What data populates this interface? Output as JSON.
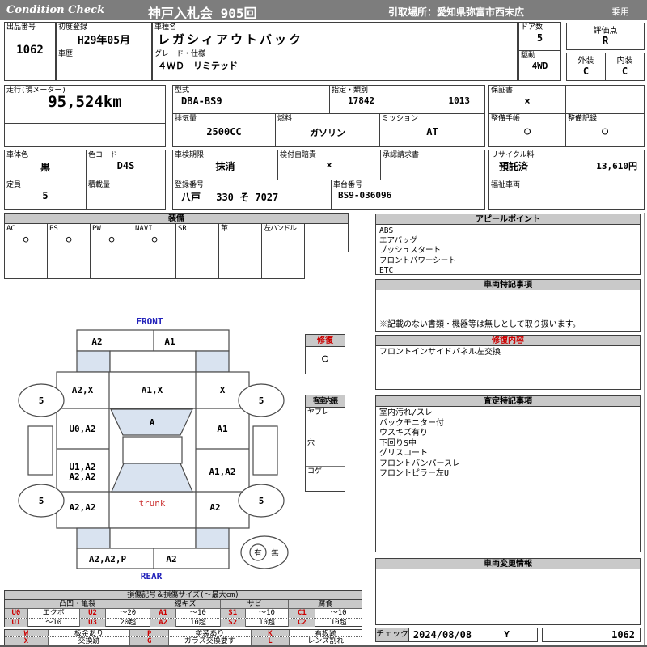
{
  "header": {
    "brand": "Condition  Check",
    "auction_title": "神戸入札会  905回",
    "pickup": "引取場所：愛知県弥富市西末広",
    "vehicle_class": "乗用"
  },
  "info": {
    "lot_label": "出品番号",
    "lot": "1062",
    "first_reg_label": "初度登録",
    "first_reg": "H29年05月",
    "history_label": "車歴",
    "model_label": "車種名",
    "model": "レガシィアウトバック",
    "grade_label": "グレード・仕様",
    "grade": "４ＷＤ　リミテッド",
    "doors_label": "ドア数",
    "doors": "5",
    "rating_label": "評価点",
    "rating": "R",
    "drive_label": "駆動",
    "drive": "4WD",
    "exterior_label": "外装",
    "exterior": "C",
    "interior_label": "内装",
    "interior": "C",
    "mileage_label": "走行(現メーター)",
    "mileage": "95,524km",
    "type_code_label": "型式",
    "type_code": "DBA-BS9",
    "class_label": "指定・類別",
    "class_no": "17842",
    "class_sub": "1013",
    "warranty_label": "保証書",
    "warranty": "×",
    "displacement_label": "排気量",
    "displacement": "2500CC",
    "fuel_label": "燃料",
    "fuel": "ガソリン",
    "mission_label": "ミッション",
    "mission": "AT",
    "book_label": "整備手帳",
    "book": "○",
    "record_label": "整備記録",
    "record": "○",
    "body_color_label": "車体色",
    "body_color": "黒",
    "color_code_label": "色コード",
    "color_code": "D4S",
    "inspection_label": "車検期限",
    "inspection": "抹消",
    "insurance_label": "検付自賠責",
    "insurance": "×",
    "approval_label": "承認請求書",
    "recycle_label": "リサイクル料",
    "recycle_status": "預託済",
    "recycle_fee": "13,610円",
    "capacity_label": "定員",
    "capacity": "5",
    "load_label": "積載量",
    "reg_no_label": "登録番号",
    "reg_no": "八戸　 330 そ 7027",
    "chassis_label": "車台番号",
    "chassis": "BS9-036096",
    "welfare_label": "福祉車両"
  },
  "equipment": {
    "title": "装備",
    "items": [
      {
        "label": "AC",
        "value": "○"
      },
      {
        "label": "PS",
        "value": "○"
      },
      {
        "label": "PW",
        "value": "○"
      },
      {
        "label": "NAVI",
        "value": "○"
      },
      {
        "label": "SR",
        "value": ""
      },
      {
        "label": "革",
        "value": ""
      },
      {
        "label": "左ハンドル",
        "value": ""
      },
      {
        "label": "",
        "value": ""
      }
    ]
  },
  "panels": {
    "appeal": {
      "title": "アピールポイント",
      "items": "ABS\nエアバッグ\nプッシュスタート\nフロントパワーシート\nETC"
    },
    "notes": {
      "title": "車両特記事項",
      "note": "※記載のない書類・機器等は無しとして取り扱います。"
    },
    "repair": {
      "title": "修復内容",
      "items": "フロントインサイドパネル左交換"
    },
    "assessment": {
      "title": "査定特記事項",
      "items": "室内汚れ/スレ\nバックモニター付\nウスキズ有り\n下回りS中\nグリスコート\nフロントバンパースレ\nフロントピラー左U"
    },
    "change": {
      "title": "車両変更情報"
    },
    "check": {
      "label": "チェック",
      "date": "2024/08/08",
      "inspector": "Y",
      "lot": "1062"
    }
  },
  "diagram": {
    "front": "FRONT",
    "rear": "REAR",
    "cells": {
      "front_bumper_l": "A2",
      "front_bumper_r": "A1",
      "fender_fl": "A2,X",
      "hood": "A1,X",
      "fender_fr": "X",
      "door_fl": "U0,A2",
      "windshield": "A",
      "door_fr": "A1",
      "door_rl1": "U1,A2",
      "door_rl2": "A2,A2",
      "door_rr": "A1,A2",
      "quarter_l": "A2,A2",
      "trunk": "trunk",
      "quarter_r": "A2",
      "rear_bumper_l": "A2,A2,P",
      "rear_bumper_r": "A2"
    },
    "tire": "5",
    "repair_mark": {
      "title": "修復",
      "value": "○"
    },
    "interior_box": {
      "title": "客室内張",
      "r1": "ヤブレ",
      "r2": "穴",
      "r3": "コゲ"
    },
    "presence": {
      "yes": "有",
      "no": "無"
    }
  },
  "legend": {
    "title": "損傷記号＆損傷サイズ(～最大cm)",
    "groups": [
      "凸凹・亀裂",
      "線キズ",
      "サビ",
      "腐食"
    ],
    "rows": [
      [
        "U0",
        "エクボ",
        "U2",
        "～20",
        "A1",
        "～10",
        "S1",
        "～10",
        "C1",
        "～10"
      ],
      [
        "U1",
        "～10",
        "U3",
        "20超",
        "A2",
        "10超",
        "S2",
        "10超",
        "C2",
        "10超"
      ]
    ],
    "rows2": [
      [
        "W",
        "板金あり",
        "P",
        "塗装あり",
        "K",
        "看板跡"
      ],
      [
        "X",
        "交換跡",
        "G",
        "ガラス交換要す",
        "L",
        "レンズ割れ"
      ]
    ]
  }
}
